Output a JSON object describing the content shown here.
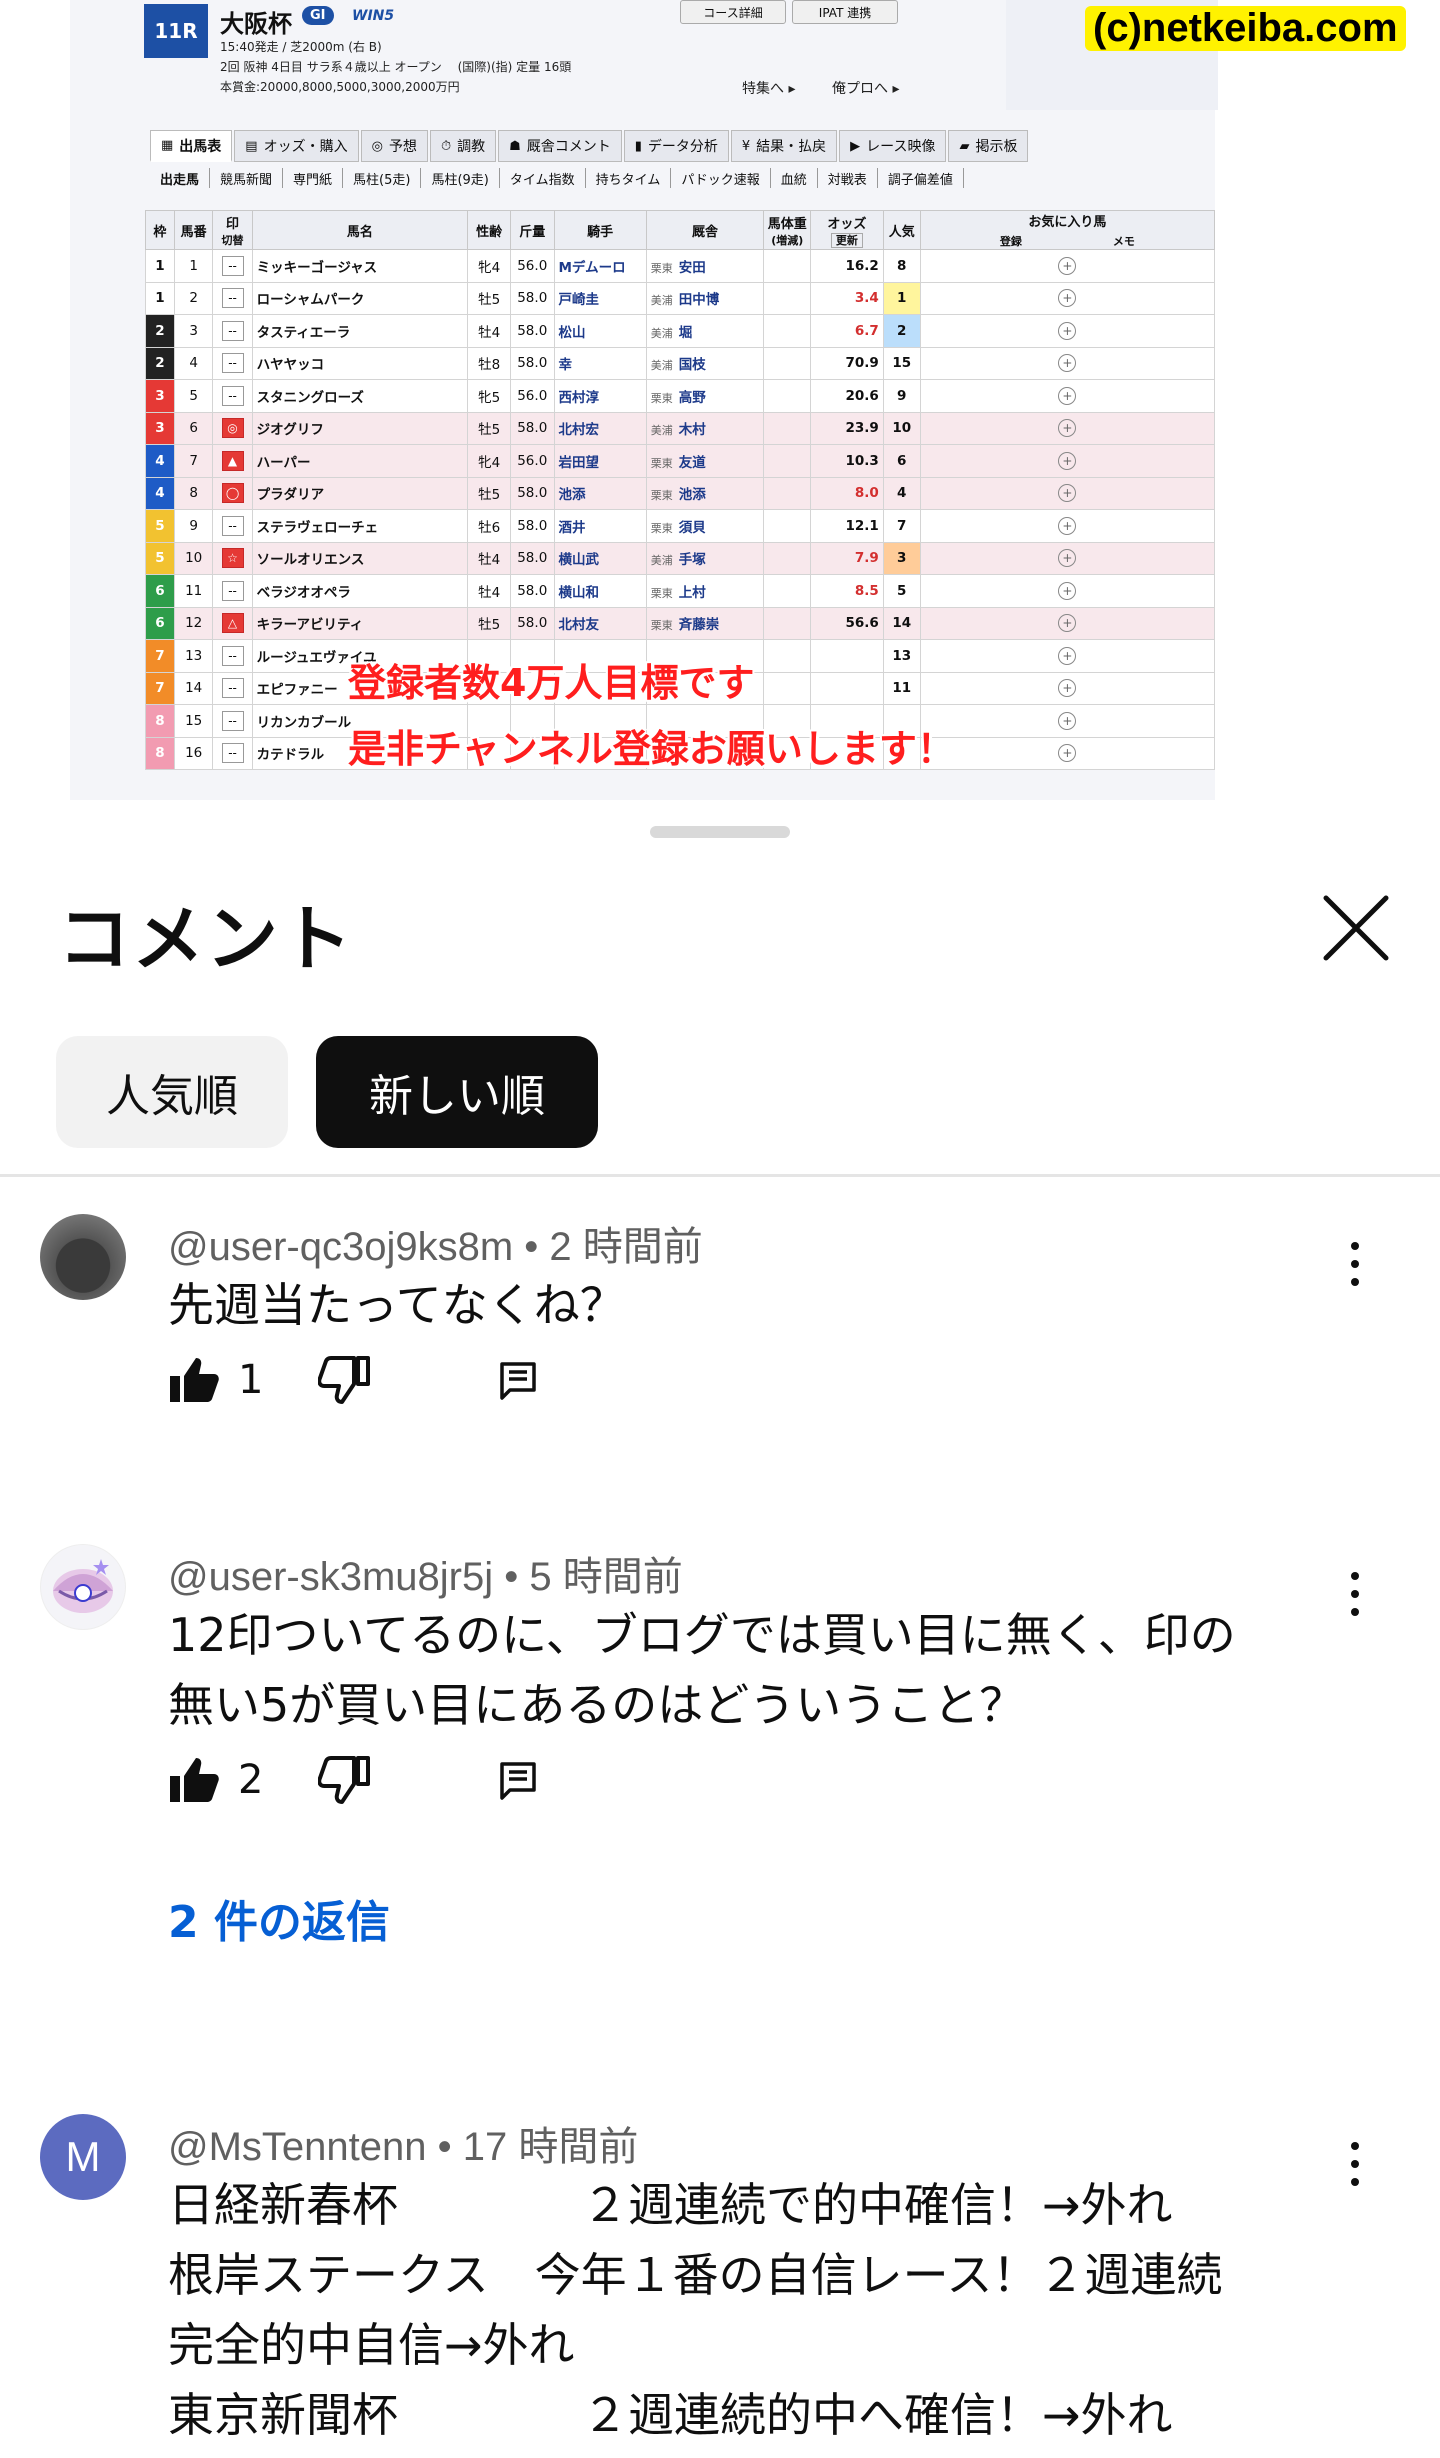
{
  "video": {
    "race": {
      "number": "11R",
      "name": "大阪杯",
      "grade": "GI",
      "win5": "WIN5",
      "line1": "15:40発走 / 芝2000m (右 B)",
      "line2": "2回 阪神 4日目 サラ系４歳以上 オープン　 (国際)(指) 定量 16頭",
      "line3": "本賞金:20000,8000,5000,3000,2000万円"
    },
    "top_buttons": [
      "コース詳細",
      "IPAT 連携"
    ],
    "top_links": [
      "特集へ ▸",
      "俺プロへ ▸"
    ],
    "watermark": "(c)netkeiba.com",
    "tabs": [
      {
        "icon": "▦",
        "label": "出馬表"
      },
      {
        "icon": "▤",
        "label": "オッズ・購入"
      },
      {
        "icon": "◎",
        "label": "予想"
      },
      {
        "icon": "⏱",
        "label": "調教"
      },
      {
        "icon": "☗",
        "label": "厩舎コメント"
      },
      {
        "icon": "▮",
        "label": "データ分析"
      },
      {
        "icon": "¥",
        "label": "結果・払戻"
      },
      {
        "icon": "▶",
        "label": "レース映像"
      },
      {
        "icon": "▰",
        "label": "掲示板"
      }
    ],
    "subtabs": [
      "出走馬",
      "競馬新聞",
      "専門紙",
      "馬柱(5走)",
      "馬柱(9走)",
      "タイム指数",
      "持ちタイム",
      "パドック速報",
      "血統",
      "対戦表",
      "調子偏差値"
    ],
    "table_headers": {
      "waku": "枠",
      "umaban": "馬番",
      "mark": "印",
      "mark_sub": "切替",
      "name": "馬名",
      "sexage": "性齢",
      "weight": "斤量",
      "jockey": "騎手",
      "stable": "厩舎",
      "bodyweight": "馬体重",
      "bodyweight_sub": "(増減)",
      "odds": "オッズ",
      "odds_sub": "更新",
      "ninki": "人気",
      "fav_group": "お気に入り馬",
      "fav_reg": "登録",
      "fav_memo": "メモ"
    },
    "waku_colors": {
      "1": "#ffffff",
      "2": "#222222",
      "3": "#e53935",
      "4": "#1e5bc6",
      "5": "#f2c230",
      "6": "#2e9d4a",
      "7": "#f28c28",
      "8": "#f29bb1"
    },
    "entries": [
      {
        "waku": "1",
        "umaban": "1",
        "mark": "--",
        "name": "ミッキーゴージャス",
        "sexage": "牝4",
        "weight": "56.0",
        "jockey": "Mデムーロ",
        "region": "栗東",
        "trainer": "安田",
        "odds": "16.2",
        "ninki": "8"
      },
      {
        "waku": "1",
        "umaban": "2",
        "mark": "--",
        "name": "ローシャムパーク",
        "sexage": "牡5",
        "weight": "58.0",
        "jockey": "戸崎圭",
        "region": "美浦",
        "trainer": "田中博",
        "odds": "3.4",
        "ninki": "1"
      },
      {
        "waku": "2",
        "umaban": "3",
        "mark": "--",
        "name": "タスティエーラ",
        "sexage": "牡4",
        "weight": "58.0",
        "jockey": "松山",
        "region": "美浦",
        "trainer": "堀",
        "odds": "6.7",
        "ninki": "2"
      },
      {
        "waku": "2",
        "umaban": "4",
        "mark": "--",
        "name": "ハヤヤッコ",
        "sexage": "牡8",
        "weight": "58.0",
        "jockey": "幸",
        "region": "美浦",
        "trainer": "国枝",
        "odds": "70.9",
        "ninki": "15"
      },
      {
        "waku": "3",
        "umaban": "5",
        "mark": "--",
        "name": "スタニングローズ",
        "sexage": "牝5",
        "weight": "56.0",
        "jockey": "西村淳",
        "region": "栗東",
        "trainer": "高野",
        "odds": "20.6",
        "ninki": "9"
      },
      {
        "waku": "3",
        "umaban": "6",
        "mark": "◎",
        "name": "ジオグリフ",
        "sexage": "牡5",
        "weight": "58.0",
        "jockey": "北村宏",
        "region": "美浦",
        "trainer": "木村",
        "odds": "23.9",
        "ninki": "10"
      },
      {
        "waku": "4",
        "umaban": "7",
        "mark": "▲",
        "name": "ハーパー",
        "sexage": "牝4",
        "weight": "56.0",
        "jockey": "岩田望",
        "region": "栗東",
        "trainer": "友道",
        "odds": "10.3",
        "ninki": "6"
      },
      {
        "waku": "4",
        "umaban": "8",
        "mark": "◯",
        "name": "プラダリア",
        "sexage": "牡5",
        "weight": "58.0",
        "jockey": "池添",
        "region": "栗東",
        "trainer": "池添",
        "odds": "8.0",
        "ninki": "4"
      },
      {
        "waku": "5",
        "umaban": "9",
        "mark": "--",
        "name": "ステラヴェローチェ",
        "sexage": "牡6",
        "weight": "58.0",
        "jockey": "酒井",
        "region": "栗東",
        "trainer": "須貝",
        "odds": "12.1",
        "ninki": "7"
      },
      {
        "waku": "5",
        "umaban": "10",
        "mark": "☆",
        "name": "ソールオリエンス",
        "sexage": "牡4",
        "weight": "58.0",
        "jockey": "横山武",
        "region": "美浦",
        "trainer": "手塚",
        "odds": "7.9",
        "ninki": "3"
      },
      {
        "waku": "6",
        "umaban": "11",
        "mark": "--",
        "name": "ベラジオオペラ",
        "sexage": "牡4",
        "weight": "58.0",
        "jockey": "横山和",
        "region": "栗東",
        "trainer": "上村",
        "odds": "8.5",
        "ninki": "5"
      },
      {
        "waku": "6",
        "umaban": "12",
        "mark": "△",
        "name": "キラーアビリティ",
        "sexage": "牡5",
        "weight": "58.0",
        "jockey": "北村友",
        "region": "栗東",
        "trainer": "斉藤崇",
        "odds": "56.6",
        "ninki": "14"
      },
      {
        "waku": "7",
        "umaban": "13",
        "mark": "--",
        "name": "ルージュエヴァイユ",
        "sexage": "",
        "weight": "",
        "jockey": "",
        "region": "",
        "trainer": "",
        "odds": "",
        "ninki": "13"
      },
      {
        "waku": "7",
        "umaban": "14",
        "mark": "--",
        "name": "エピファニー",
        "sexage": "",
        "weight": "",
        "jockey": "",
        "region": "",
        "trainer": "",
        "odds": "",
        "ninki": "11"
      },
      {
        "waku": "8",
        "umaban": "15",
        "mark": "--",
        "name": "リカンカブール",
        "sexage": "",
        "weight": "",
        "jockey": "",
        "region": "",
        "trainer": "",
        "odds": "",
        "ninki": ""
      },
      {
        "waku": "8",
        "umaban": "16",
        "mark": "--",
        "name": "カテドラル",
        "sexage": "",
        "weight": "",
        "jockey": "",
        "region": "",
        "trainer": "",
        "odds": "",
        "ninki": ""
      }
    ],
    "overlay_lines": [
      "登録者数4万人目標です",
      "是非チャンネル登録お願いします！"
    ]
  },
  "comments_panel": {
    "title": "コメント",
    "close_icon": "close-icon",
    "sort_chips": [
      {
        "label": "人気順",
        "selected": false
      },
      {
        "label": "新しい順",
        "selected": true
      }
    ],
    "comments": [
      {
        "author": "@user-qc3oj9ks8m",
        "time": "2 時間前",
        "text": "先週当たってなくね？",
        "likes": "1",
        "replies": ""
      },
      {
        "author": "@user-sk3mu8jr5j",
        "time": "5 時間前",
        "text": "12印ついてるのに、ブログでは買い目に無く、印の\n無い5が買い目にあるのはどういうこと？",
        "likes": "2",
        "replies": "2 件の返信"
      },
      {
        "author": "@MsTenntenn",
        "time": "17 時間前",
        "avatar_letter": "M",
        "text": "日経新春杯　　　　２週連続で的中確信！→外れ\n根岸ステークス　今年１番の自信レース！２週連続\n完全的中自信→外れ\n東京新聞杯　　　　２週連続的中へ確信！→外れ",
        "likes": "",
        "replies": ""
      }
    ]
  },
  "colors": {
    "accent_link": "#065fd4",
    "chip_selected_bg": "#0f0f0f",
    "chip_bg": "#f2f2f2",
    "overlay_text": "#ff1e1e"
  }
}
